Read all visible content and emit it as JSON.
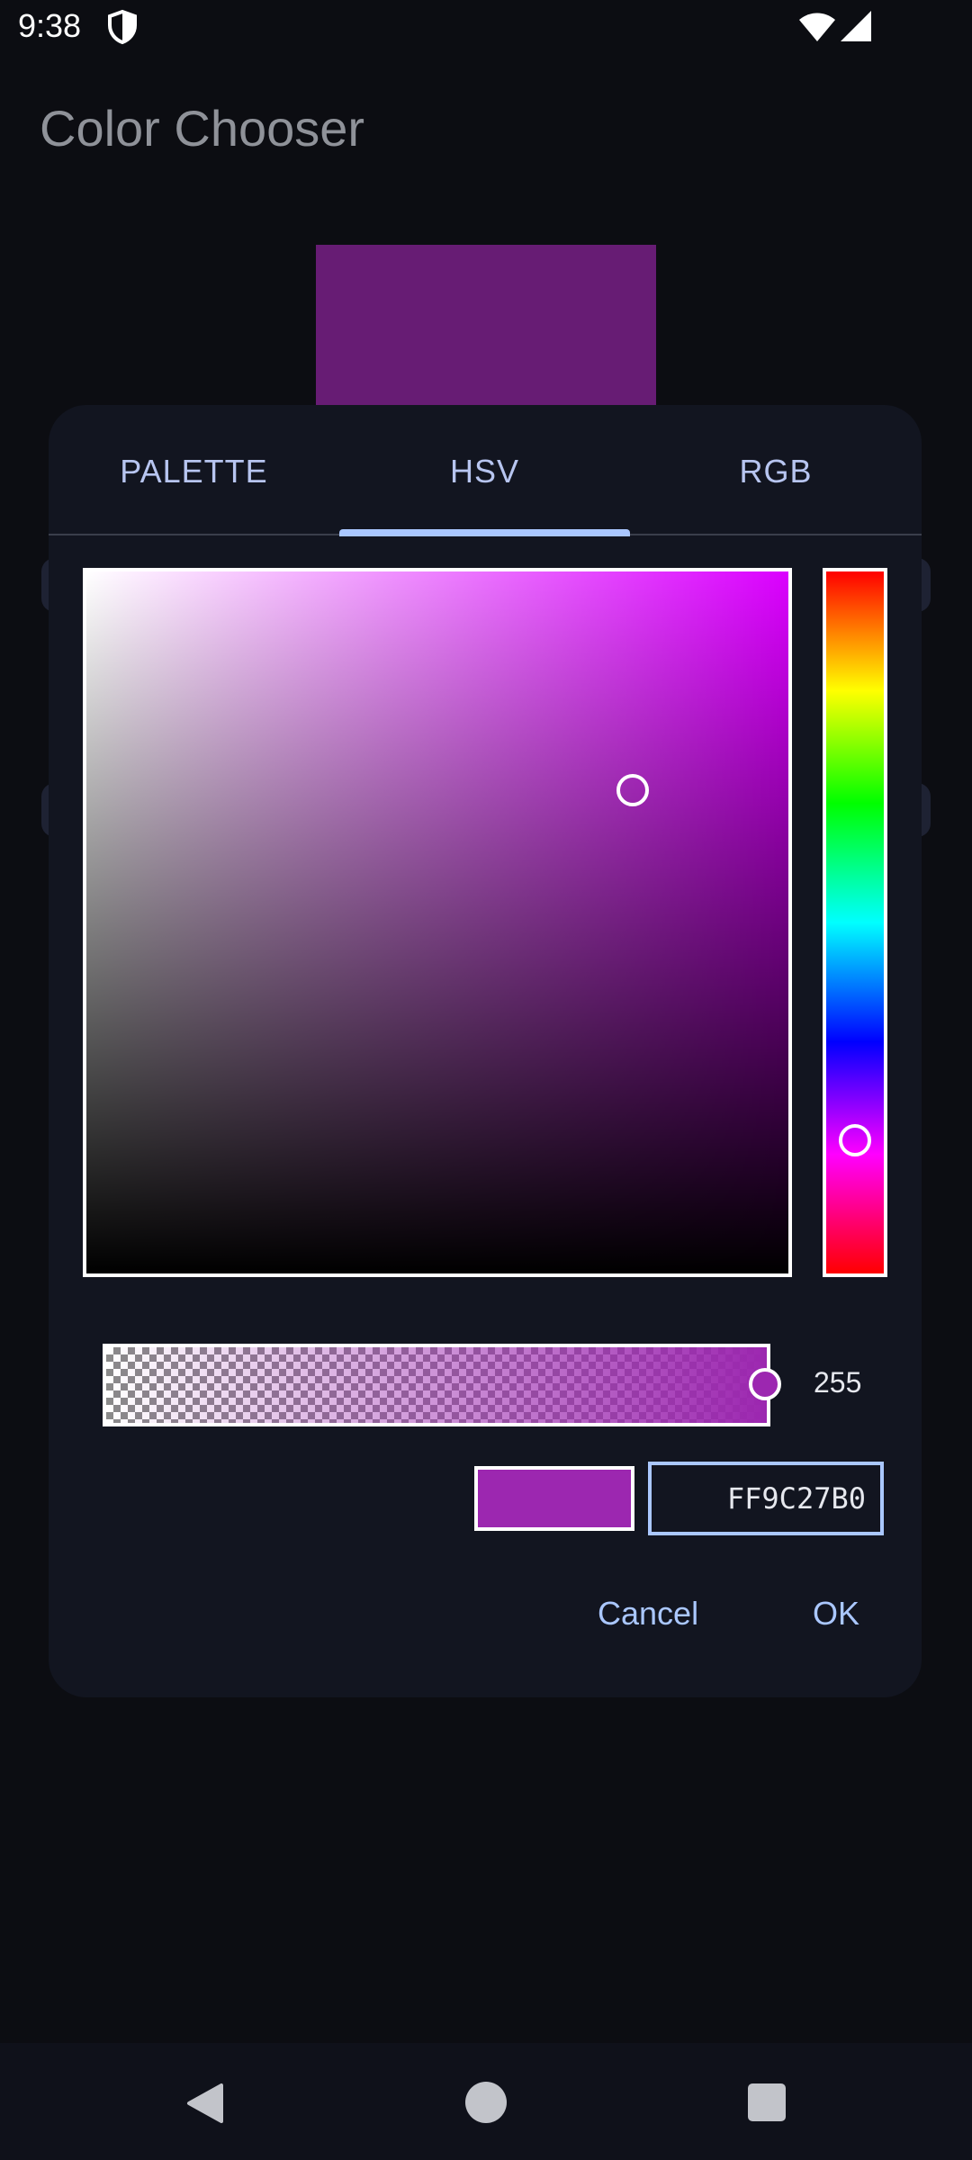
{
  "status_bar": {
    "time": "9:38",
    "icons": [
      "shield-icon",
      "wifi-icon",
      "cellular-signal-icon"
    ]
  },
  "app_bar": {
    "title": "Color Chooser"
  },
  "preview": {
    "color": "#671c74"
  },
  "dialog": {
    "tabs": [
      {
        "label": "PALETTE",
        "selected": false
      },
      {
        "label": "HSV",
        "selected": true
      },
      {
        "label": "RGB",
        "selected": false
      }
    ],
    "hsv": {
      "hue_color": "#db00ff",
      "saturation_value_thumb_color": "#9c27b0"
    },
    "alpha": {
      "value": "255"
    },
    "selected_color": "#9c27b0",
    "hex": {
      "value": "FF9C27B0"
    },
    "buttons": {
      "cancel": "Cancel",
      "ok": "OK"
    }
  },
  "theme": {
    "accent": "#aac7ff",
    "background": "#0c0d12",
    "dialog": "#121520"
  },
  "nav_bar": {
    "icons": [
      "back-icon",
      "home-icon",
      "recents-icon"
    ]
  }
}
